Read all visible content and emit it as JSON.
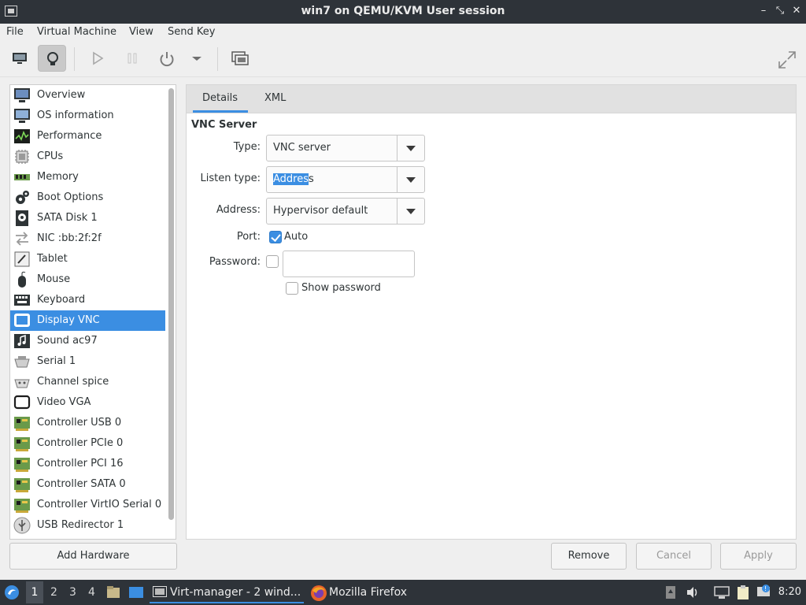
{
  "window": {
    "title": "win7 on QEMU/KVM User session"
  },
  "menu": [
    "File",
    "Virtual Machine",
    "View",
    "Send Key"
  ],
  "sidebar": {
    "items": [
      {
        "label": "Overview",
        "icon": "monitor-icon"
      },
      {
        "label": "OS information",
        "icon": "monitor-info-icon"
      },
      {
        "label": "Performance",
        "icon": "performance-graph-icon"
      },
      {
        "label": "CPUs",
        "icon": "cpu-chip-icon"
      },
      {
        "label": "Memory",
        "icon": "memory-module-icon"
      },
      {
        "label": "Boot Options",
        "icon": "gears-icon"
      },
      {
        "label": "SATA Disk 1",
        "icon": "hard-disk-icon"
      },
      {
        "label": "NIC :bb:2f:2f",
        "icon": "network-arrows-icon"
      },
      {
        "label": "Tablet",
        "icon": "tablet-icon"
      },
      {
        "label": "Mouse",
        "icon": "mouse-icon"
      },
      {
        "label": "Keyboard",
        "icon": "keyboard-icon"
      },
      {
        "label": "Display VNC",
        "icon": "display-icon",
        "selected": true
      },
      {
        "label": "Sound ac97",
        "icon": "sound-icon"
      },
      {
        "label": "Serial 1",
        "icon": "serial-port-icon"
      },
      {
        "label": "Channel spice",
        "icon": "channel-icon"
      },
      {
        "label": "Video VGA",
        "icon": "video-card-icon"
      },
      {
        "label": "Controller USB 0",
        "icon": "controller-card-icon"
      },
      {
        "label": "Controller PCIe 0",
        "icon": "controller-card-icon"
      },
      {
        "label": "Controller PCI 16",
        "icon": "controller-card-icon"
      },
      {
        "label": "Controller SATA 0",
        "icon": "controller-card-icon"
      },
      {
        "label": "Controller VirtIO Serial 0",
        "icon": "controller-card-icon"
      },
      {
        "label": "USB Redirector 1",
        "icon": "usb-icon"
      }
    ],
    "add_hardware": "Add Hardware"
  },
  "tabs": {
    "details": "Details",
    "xml": "XML"
  },
  "vnc": {
    "section_title": "VNC Server",
    "type_label": "Type:",
    "type_value": "VNC server",
    "listen_label": "Listen type:",
    "listen_selected": "Addres",
    "listen_rest": "s",
    "address_label": "Address:",
    "address_value": "Hypervisor default",
    "port_label": "Port:",
    "port_auto": "Auto",
    "port_auto_checked": true,
    "password_label": "Password:",
    "password_checked": false,
    "password_value": "",
    "show_password": "Show password",
    "show_password_checked": false
  },
  "buttons": {
    "remove": "Remove",
    "cancel": "Cancel",
    "apply": "Apply"
  },
  "taskbar": {
    "workspaces": [
      "1",
      "2",
      "3",
      "4"
    ],
    "current_workspace": "1",
    "tasks": [
      "Virt-manager - 2 wind...",
      "Mozilla Firefox"
    ],
    "clock": "8:20"
  },
  "colors": {
    "accent": "#3b8ee2",
    "titlebar": "#2e3339"
  }
}
